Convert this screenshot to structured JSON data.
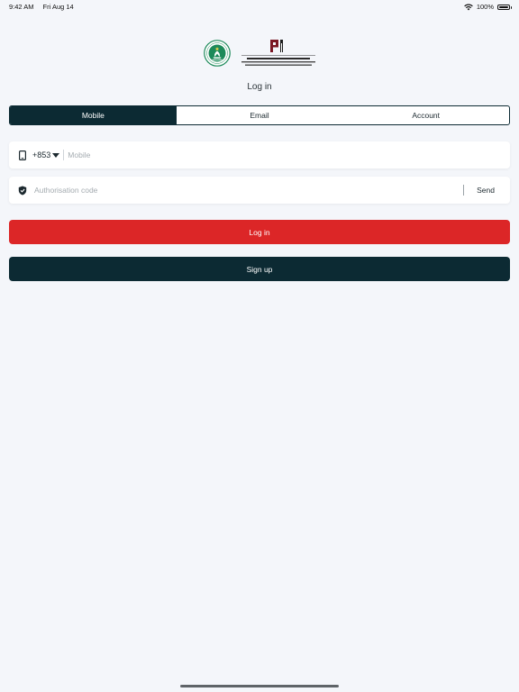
{
  "status_bar": {
    "time": "9:42 AM",
    "date": "Fri Aug 14",
    "battery": "100%"
  },
  "logos": {
    "left_logo_icon": "macau-sar-emblem",
    "right_logo_icon": "ipim-logo"
  },
  "page_title": "Log in",
  "tabs": [
    {
      "label": "Mobile",
      "active": true
    },
    {
      "label": "Email",
      "active": false
    },
    {
      "label": "Account",
      "active": false
    }
  ],
  "mobile_field": {
    "icon": "phone-icon",
    "country_code": "+853",
    "placeholder": "Mobile",
    "value": ""
  },
  "code_field": {
    "icon": "shield-check-icon",
    "placeholder": "Authorisation code",
    "value": "",
    "send_label": "Send"
  },
  "buttons": {
    "login_label": "Log in",
    "signup_label": "Sign up"
  },
  "colors": {
    "primary_dark": "#0c2a33",
    "accent_red": "#dc2627",
    "background": "#f4f6fa"
  }
}
